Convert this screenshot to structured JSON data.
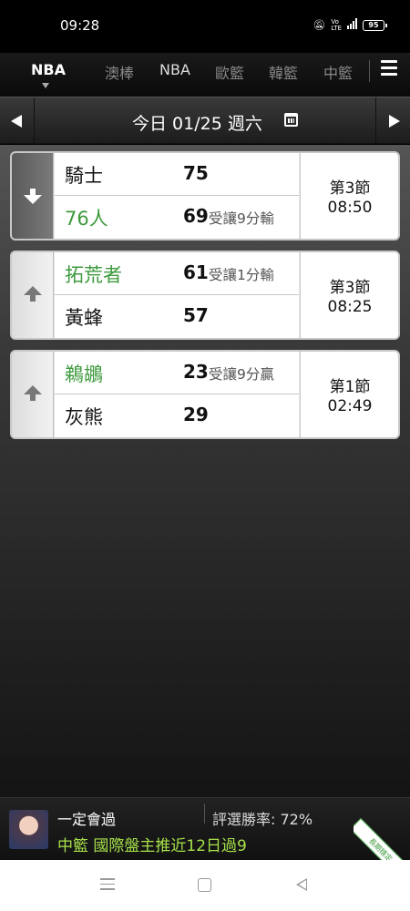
{
  "status_bar": {
    "time": "09:28",
    "icons": [
      "mute-icon",
      "volte-icon",
      "4g-icon",
      "signal-icon",
      "battery-icon"
    ],
    "battery": "95"
  },
  "tabs": [
    {
      "label": "NBA",
      "active": true
    },
    {
      "label": "澳棒",
      "active": false
    },
    {
      "label": "NBA",
      "active": false
    },
    {
      "label": "歐籃",
      "active": false
    },
    {
      "label": "韓籃",
      "active": false
    },
    {
      "label": "中籃",
      "active": false
    }
  ],
  "date_bar": {
    "label": "今日 01/25 週六"
  },
  "games": [
    {
      "trend": "down",
      "home": {
        "name": "騎士",
        "score": "75",
        "note": "",
        "favored": false
      },
      "away": {
        "name": "76人",
        "score": "69",
        "note": "受讓9分輸",
        "favored": true
      },
      "period": "第3節",
      "clock": "08:50"
    },
    {
      "trend": "up",
      "home": {
        "name": "拓荒者",
        "score": "61",
        "note": "受讓1分輸",
        "favored": true
      },
      "away": {
        "name": "黃蜂",
        "score": "57",
        "note": "",
        "favored": false
      },
      "period": "第3節",
      "clock": "08:25"
    },
    {
      "trend": "up",
      "home": {
        "name": "鵜鶘",
        "score": "23",
        "note": "受讓9分贏",
        "favored": true
      },
      "away": {
        "name": "灰熊",
        "score": "29",
        "note": "",
        "favored": false
      },
      "period": "第1節",
      "clock": "02:49"
    }
  ],
  "footer_ad": {
    "name": "一定會過",
    "rate": "評選勝率: 72%",
    "headline": "中籃 國際盤主推近12日過9",
    "ribbon": "長期穩定"
  },
  "colors": {
    "favored_team": "#3d9a3d",
    "ad_headline": "#a6e04a"
  }
}
